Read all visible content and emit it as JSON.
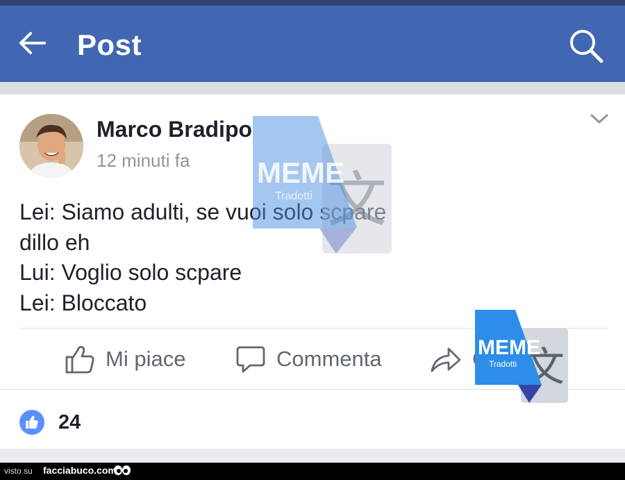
{
  "appbar": {
    "title": "Post",
    "back_icon": "arrow-left-icon",
    "search_icon": "search-icon",
    "background_color": "#4267b2"
  },
  "post": {
    "author": "Marco Bradipo",
    "time": "12 minuti fa",
    "body_lines": [
      "Lei: Siamo adulti, se vuoi solo scpare",
      "dillo eh",
      "Lui: Voglio solo scpare",
      "Lei: Bloccato"
    ]
  },
  "actions": {
    "like": "Mi piace",
    "comment": "Commenta",
    "share": "C"
  },
  "reactions": {
    "count": "24",
    "icon": "thumbs-up-icon",
    "badge_color": "#5890ff"
  },
  "watermark": {
    "brand": "MEME",
    "sub": "Tradotti"
  },
  "footer": {
    "prefix": "visto su",
    "site": "facciabuco.com"
  }
}
